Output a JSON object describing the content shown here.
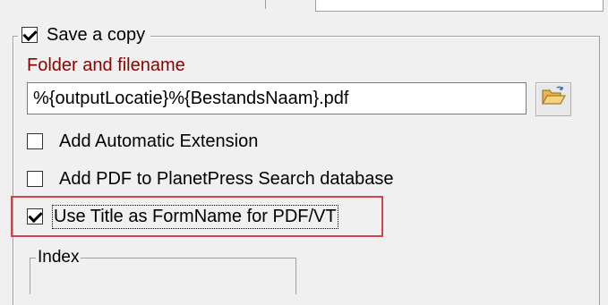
{
  "save_copy": {
    "label": "Save a copy",
    "checked": true
  },
  "folder": {
    "label": "Folder and filename",
    "value": "%{outputLocatie}%{BestandsNaam}.pdf",
    "browse_icon": "folder-open-icon"
  },
  "options": [
    {
      "label": "Add Automatic Extension",
      "checked": false
    },
    {
      "label": "Add PDF to PlanetPress Search database",
      "checked": false
    },
    {
      "label": "Use Title as FormName for PDF/VT",
      "checked": true
    }
  ],
  "index_group": {
    "label": "Index"
  },
  "colors": {
    "folder_label": "#8b0000",
    "highlight_border": "#d6424a"
  }
}
